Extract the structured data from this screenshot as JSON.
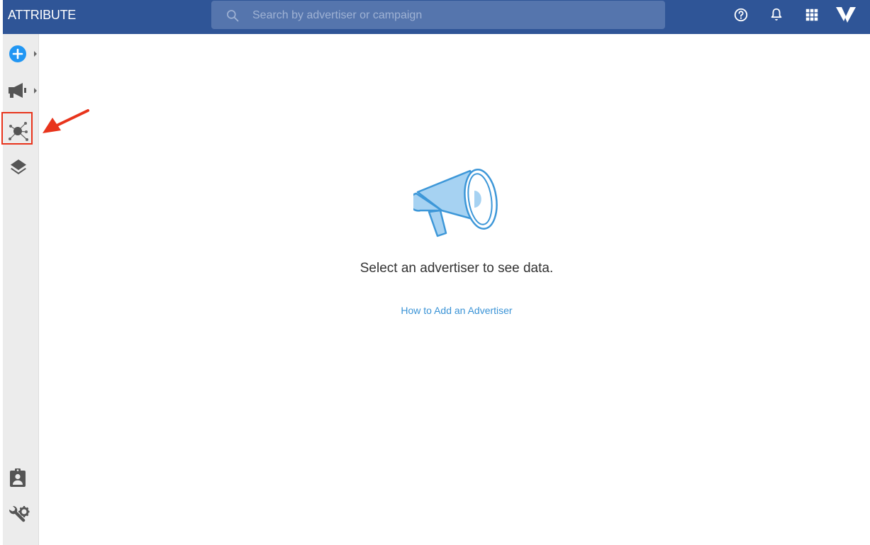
{
  "app": {
    "brand": "ATTRIBUTE"
  },
  "search": {
    "placeholder": "Search by advertiser or campaign"
  },
  "header_icons": [
    "help-icon",
    "bell-icon",
    "apps-grid-icon",
    "brand-logo-icon"
  ],
  "sidebar": {
    "items": [
      {
        "icon": "plus-circle-icon",
        "has_submenu": true
      },
      {
        "icon": "megaphone-icon",
        "has_submenu": true
      },
      {
        "icon": "network-icon",
        "highlighted": true
      },
      {
        "icon": "layers-icon"
      },
      {
        "icon": "contact-badge-icon"
      },
      {
        "icon": "settings-tools-icon"
      }
    ]
  },
  "main": {
    "message": "Select an advertiser to see data.",
    "help_link": "How to Add an Advertiser"
  },
  "colors": {
    "topbar": "#2f5597",
    "search_bg": "#5575ad",
    "sidebar_bg": "#ececec",
    "accent_blue": "#2196f3",
    "link": "#3a93d6",
    "annotation_red": "#e8341c"
  }
}
